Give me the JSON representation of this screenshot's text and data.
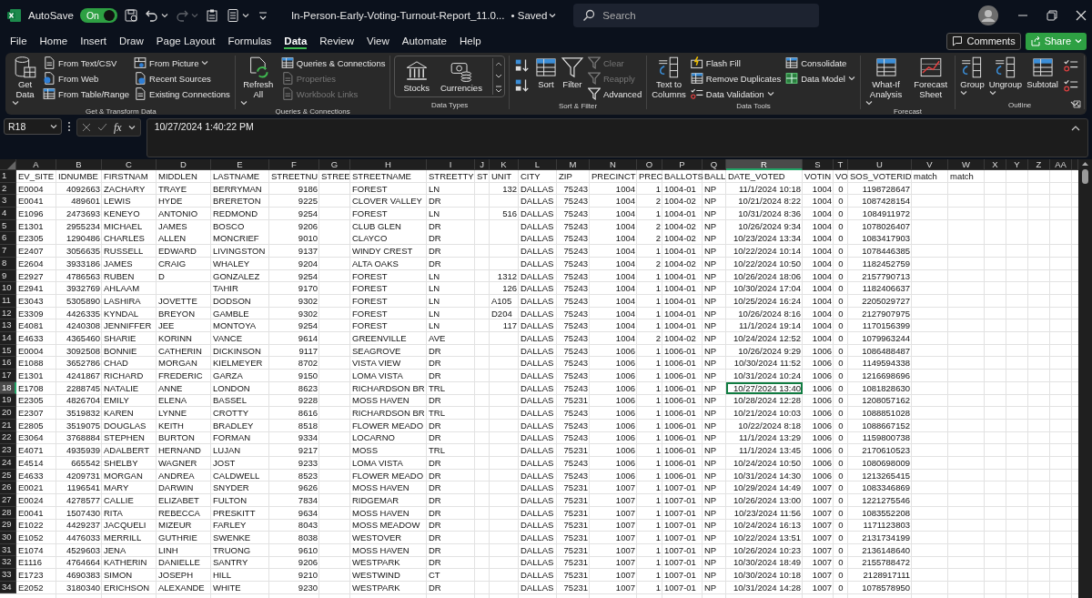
{
  "titlebar": {
    "autosave_label": "AutoSave",
    "autosave": {
      "on": true,
      "label": "On"
    },
    "quick_access": [
      {
        "disabled": false
      },
      {
        "disabled": false
      },
      {
        "disabled": true
      },
      {
        "disabled": false
      },
      {
        "disabled": false
      },
      {
        "disabled": false
      }
    ],
    "title": "In-Person-Early-Voting-Turnout-Report_11.0...",
    "save_status": "• Saved",
    "search": {
      "placeholder": "Search"
    }
  },
  "menu": {
    "tabs": [
      {
        "label": "File",
        "selected": false
      },
      {
        "label": "Home",
        "selected": false
      },
      {
        "label": "Insert",
        "selected": false
      },
      {
        "label": "Draw",
        "selected": false
      },
      {
        "label": "Page Layout",
        "selected": false
      },
      {
        "label": "Formulas",
        "selected": false
      },
      {
        "label": "Data",
        "selected": true
      },
      {
        "label": "Review",
        "selected": false
      },
      {
        "label": "View",
        "selected": false
      },
      {
        "label": "Automate",
        "selected": false
      },
      {
        "label": "Help",
        "selected": false
      }
    ],
    "comments": "Comments",
    "share": "Share"
  },
  "ribbon": {
    "groups": [
      {
        "label": "Get & Transform Data",
        "gallery": false,
        "launcher": false,
        "items": [
          {
            "kind": "large",
            "label": "Get Data",
            "dropdown": true,
            "disabled": false
          },
          {
            "kind": "small",
            "label": "From Text/CSV",
            "dropdown": false,
            "disabled": false
          },
          {
            "kind": "small",
            "label": "From Web",
            "dropdown": false,
            "disabled": false
          },
          {
            "kind": "small",
            "label": "From Table/Range",
            "dropdown": false,
            "disabled": false
          },
          {
            "kind": "small",
            "label": "From Picture",
            "dropdown": true,
            "disabled": false
          },
          {
            "kind": "small",
            "label": "Recent Sources",
            "dropdown": false,
            "disabled": false
          },
          {
            "kind": "small",
            "label": "Existing Connections",
            "dropdown": false,
            "disabled": false
          }
        ]
      },
      {
        "label": "Queries & Connections",
        "gallery": false,
        "launcher": false,
        "items": [
          {
            "kind": "large",
            "label": "Refresh All",
            "dropdown": true,
            "disabled": false
          },
          {
            "kind": "small",
            "label": "Queries & Connections",
            "dropdown": false,
            "disabled": false
          },
          {
            "kind": "small",
            "label": "Properties",
            "dropdown": false,
            "disabled": true
          },
          {
            "kind": "small",
            "label": "Workbook Links",
            "dropdown": false,
            "disabled": true
          }
        ]
      },
      {
        "label": "Data Types",
        "gallery": true,
        "launcher": false,
        "items": [
          {
            "kind": "large",
            "label": "Stocks",
            "dropdown": false,
            "disabled": false
          },
          {
            "kind": "large",
            "label": "Currencies",
            "dropdown": false,
            "disabled": false
          }
        ]
      },
      {
        "label": "Sort & Filter",
        "gallery": false,
        "launcher": false,
        "items": [
          {
            "kind": "icon",
            "dropdown": false,
            "disabled": false
          },
          {
            "kind": "icon",
            "dropdown": false,
            "disabled": false
          },
          {
            "kind": "large",
            "label": "Sort",
            "dropdown": false,
            "disabled": false
          },
          {
            "kind": "large",
            "label": "Filter",
            "dropdown": false,
            "disabled": false
          },
          {
            "kind": "small",
            "label": "Clear",
            "dropdown": false,
            "disabled": true
          },
          {
            "kind": "small",
            "label": "Reapply",
            "dropdown": false,
            "disabled": true
          },
          {
            "kind": "small",
            "label": "Advanced",
            "dropdown": false,
            "disabled": false
          }
        ]
      },
      {
        "label": "Data Tools",
        "gallery": false,
        "launcher": false,
        "items": [
          {
            "kind": "large",
            "label": "Text to Columns",
            "dropdown": false,
            "disabled": false
          },
          {
            "kind": "small",
            "label": "Flash Fill",
            "dropdown": false,
            "disabled": false
          },
          {
            "kind": "small",
            "label": "Remove Duplicates",
            "dropdown": false,
            "disabled": false
          },
          {
            "kind": "small",
            "label": "Data Validation",
            "dropdown": true,
            "disabled": false
          },
          {
            "kind": "small",
            "label": "Consolidate",
            "dropdown": false,
            "disabled": false
          },
          {
            "kind": "small",
            "label": "Data Model",
            "dropdown": true,
            "disabled": false
          }
        ]
      },
      {
        "label": "Forecast",
        "gallery": false,
        "launcher": false,
        "items": [
          {
            "kind": "large",
            "label": "What-If Analysis",
            "dropdown": true,
            "disabled": false
          },
          {
            "kind": "large",
            "label": "Forecast Sheet",
            "dropdown": false,
            "disabled": false
          }
        ]
      },
      {
        "label": "Outline",
        "gallery": false,
        "launcher": true,
        "items": [
          {
            "kind": "large",
            "label": "Group",
            "dropdown": true,
            "disabled": false
          },
          {
            "kind": "large",
            "label": "Ungroup",
            "dropdown": true,
            "disabled": false
          },
          {
            "kind": "large",
            "label": "Subtotal",
            "dropdown": false,
            "disabled": false
          },
          {
            "kind": "icon",
            "dropdown": false,
            "disabled": false
          },
          {
            "kind": "icon",
            "dropdown": false,
            "disabled": false
          }
        ]
      }
    ]
  },
  "formula_bar": {
    "name_box": "R18",
    "fx": "fx",
    "value": "10/27/2024 1:40:22 PM"
  },
  "sheet": {
    "columns": [
      {
        "letter": "A",
        "kind": "text",
        "selected": false
      },
      {
        "letter": "B",
        "kind": "number",
        "selected": false
      },
      {
        "letter": "C",
        "kind": "text",
        "selected": false
      },
      {
        "letter": "D",
        "kind": "text",
        "selected": false
      },
      {
        "letter": "E",
        "kind": "text",
        "selected": false
      },
      {
        "letter": "F",
        "kind": "number",
        "selected": false
      },
      {
        "letter": "G",
        "kind": "text",
        "selected": false
      },
      {
        "letter": "H",
        "kind": "text",
        "selected": false
      },
      {
        "letter": "I",
        "kind": "text",
        "selected": false
      },
      {
        "letter": "J",
        "kind": "text",
        "selected": false
      },
      {
        "letter": "K",
        "kind": "number",
        "selected": false
      },
      {
        "letter": "L",
        "kind": "text",
        "selected": false
      },
      {
        "letter": "M",
        "kind": "number",
        "selected": false
      },
      {
        "letter": "N",
        "kind": "number",
        "selected": false
      },
      {
        "letter": "O",
        "kind": "number",
        "selected": false
      },
      {
        "letter": "P",
        "kind": "text",
        "selected": false
      },
      {
        "letter": "Q",
        "kind": "text",
        "selected": false
      },
      {
        "letter": "R",
        "kind": "number",
        "selected": true
      },
      {
        "letter": "S",
        "kind": "number",
        "selected": false
      },
      {
        "letter": "T",
        "kind": "flag",
        "selected": false
      },
      {
        "letter": "U",
        "kind": "number",
        "selected": false
      },
      {
        "letter": "V",
        "kind": "text",
        "selected": false
      },
      {
        "letter": "W",
        "kind": "text",
        "selected": false
      },
      {
        "letter": "X",
        "selected": false
      },
      {
        "letter": "Y",
        "selected": false
      },
      {
        "letter": "Z",
        "selected": false
      },
      {
        "letter": "AA",
        "selected": false
      }
    ],
    "rows": [
      {
        "number": "1",
        "kind": "header",
        "selected": false,
        "cells": [
          "EV_SITE",
          "IDNUMBE",
          "FIRSTNAM",
          "MIDDLEN",
          "LASTNAME",
          "STREETNU",
          "STREE",
          "STREETNAME",
          "STREETTY",
          "ST",
          "UNIT",
          "CITY",
          "ZIP",
          "PRECINCT",
          "PREC",
          "BALLOTS",
          "BALL",
          "DATE_VOTED",
          "VOTIN",
          "VO",
          "SOS_VOTERID",
          "match",
          "match"
        ]
      },
      {
        "number": "2",
        "kind": "data",
        "selected": false,
        "cells": [
          "E0004",
          "4092663",
          "ZACHARY",
          "TRAYE",
          "BERRYMAN",
          "9186",
          null,
          "FOREST",
          "LN",
          null,
          "132",
          "DALLAS",
          "75243",
          "1004",
          "1",
          "1004-01",
          "NP",
          "11/1/2024 10:18",
          "1004",
          "0",
          "1198728647"
        ]
      },
      {
        "number": "3",
        "kind": "data",
        "selected": false,
        "cells": [
          "E0041",
          "489601",
          "LEWIS",
          "HYDE",
          "BRERETON",
          "9225",
          null,
          "CLOVER VALLEY",
          "DR",
          null,
          null,
          "DALLAS",
          "75243",
          "1004",
          "2",
          "1004-02",
          "NP",
          "10/21/2024 8:22",
          "1004",
          "0",
          "1087428154"
        ]
      },
      {
        "number": "4",
        "kind": "data",
        "selected": false,
        "cells": [
          "E1096",
          "2473693",
          "KENEYO",
          "ANTONIO",
          "REDMOND",
          "9254",
          null,
          "FOREST",
          "LN",
          null,
          "516",
          "DALLAS",
          "75243",
          "1004",
          "1",
          "1004-01",
          "NP",
          "10/31/2024 8:36",
          "1004",
          "0",
          "1084911972"
        ]
      },
      {
        "number": "5",
        "kind": "data",
        "selected": false,
        "cells": [
          "E1301",
          "2955234",
          "MICHAEL",
          "JAMES",
          "BOSCO",
          "9206",
          null,
          "CLUB GLEN",
          "DR",
          null,
          null,
          "DALLAS",
          "75243",
          "1004",
          "2",
          "1004-02",
          "NP",
          "10/26/2024 9:34",
          "1004",
          "0",
          "1078026407"
        ]
      },
      {
        "number": "6",
        "kind": "data",
        "selected": false,
        "cells": [
          "E2305",
          "1290486",
          "CHARLES",
          "ALLEN",
          "MONCRIEF",
          "9010",
          null,
          "CLAYCO",
          "DR",
          null,
          null,
          "DALLAS",
          "75243",
          "1004",
          "2",
          "1004-02",
          "NP",
          "10/23/2024 13:34",
          "1004",
          "0",
          "1083417903"
        ]
      },
      {
        "number": "7",
        "kind": "data",
        "selected": false,
        "cells": [
          "E2407",
          "3056635",
          "RUSSELL",
          "EDWARD",
          "LIVINGSTON",
          "9137",
          null,
          "WINDY CREST",
          "DR",
          null,
          null,
          "DALLAS",
          "75243",
          "1004",
          "1",
          "1004-01",
          "NP",
          "10/22/2024 10:14",
          "1004",
          "0",
          "1078446385"
        ]
      },
      {
        "number": "8",
        "kind": "data",
        "selected": false,
        "cells": [
          "E2604",
          "3933186",
          "JAMES",
          "CRAIG",
          "WHALEY",
          "9204",
          null,
          "ALTA OAKS",
          "DR",
          null,
          null,
          "DALLAS",
          "75243",
          "1004",
          "2",
          "1004-02",
          "NP",
          "10/22/2024 10:50",
          "1004",
          "0",
          "1182452759"
        ]
      },
      {
        "number": "9",
        "kind": "data",
        "selected": false,
        "cells": [
          "E2927",
          "4786563",
          "RUBEN",
          "D",
          "GONZALEZ",
          "9254",
          null,
          "FOREST",
          "LN",
          null,
          "1312",
          "DALLAS",
          "75243",
          "1004",
          "1",
          "1004-01",
          "NP",
          "10/26/2024 18:06",
          "1004",
          "0",
          "2157790713"
        ]
      },
      {
        "number": "10",
        "kind": "data",
        "selected": false,
        "cells": [
          "E2941",
          "3932769",
          "AHLAAM",
          null,
          "TAHIR",
          "9170",
          null,
          "FOREST",
          "LN",
          null,
          "126",
          "DALLAS",
          "75243",
          "1004",
          "1",
          "1004-01",
          "NP",
          "10/30/2024 17:04",
          "1004",
          "0",
          "1182406637"
        ]
      },
      {
        "number": "11",
        "kind": "data",
        "selected": false,
        "cells": [
          "E3043",
          "5305890",
          "LASHIRA",
          "JOVETTE",
          "DODSON",
          "9302",
          null,
          "FOREST",
          "LN",
          null,
          {
            "text": "A105",
            "kind": "text"
          },
          "DALLAS",
          "75243",
          "1004",
          "1",
          "1004-01",
          "NP",
          "10/25/2024 16:24",
          "1004",
          "0",
          "2205029727"
        ]
      },
      {
        "number": "12",
        "kind": "data",
        "selected": false,
        "cells": [
          "E3309",
          "4426335",
          "KYNDAL",
          "BREYON",
          "GAMBLE",
          "9302",
          null,
          "FOREST",
          "LN",
          null,
          {
            "text": "D204",
            "kind": "text"
          },
          "DALLAS",
          "75243",
          "1004",
          "1",
          "1004-01",
          "NP",
          "10/26/2024 8:16",
          "1004",
          "0",
          "2127907975"
        ]
      },
      {
        "number": "13",
        "kind": "data",
        "selected": false,
        "cells": [
          "E4081",
          "4240308",
          "JENNIFFER",
          "JEE",
          "MONTOYA",
          "9254",
          null,
          "FOREST",
          "LN",
          null,
          "117",
          "DALLAS",
          "75243",
          "1004",
          "1",
          "1004-01",
          "NP",
          "11/1/2024 19:14",
          "1004",
          "0",
          "1170156399"
        ]
      },
      {
        "number": "14",
        "kind": "data",
        "selected": false,
        "cells": [
          "E4633",
          "4365460",
          "SHARIE",
          "KORINN",
          "VANCE",
          "9614",
          null,
          "GREENVILLE",
          "AVE",
          null,
          null,
          "DALLAS",
          "75243",
          "1004",
          "2",
          "1004-02",
          "NP",
          "10/24/2024 12:52",
          "1004",
          "0",
          "1079963244"
        ]
      },
      {
        "number": "15",
        "kind": "data",
        "selected": false,
        "cells": [
          "E0004",
          "3092508",
          "BONNIE",
          "CATHERIN",
          "DICKINSON",
          "9117",
          null,
          "SEAGROVE",
          "DR",
          null,
          null,
          "DALLAS",
          "75243",
          "1006",
          "1",
          "1006-01",
          "NP",
          "10/26/2024 9:29",
          "1006",
          "0",
          "1086488487"
        ]
      },
      {
        "number": "16",
        "kind": "data",
        "selected": false,
        "cells": [
          "E1088",
          "3652786",
          "CHAD",
          "MORGAN",
          "KIELMEYER",
          "8702",
          null,
          "VISTA VIEW",
          "DR",
          null,
          null,
          "DALLAS",
          "75243",
          "1006",
          "1",
          "1006-01",
          "NP",
          "10/30/2024 11:52",
          "1006",
          "0",
          "1149594338"
        ]
      },
      {
        "number": "17",
        "kind": "data",
        "selected": false,
        "cells": [
          "E1301",
          "4241867",
          "RICHARD",
          "FREDERIC",
          "GARZA",
          "9150",
          null,
          "LOMA VISTA",
          "DR",
          null,
          null,
          "DALLAS",
          "75243",
          "1006",
          "1",
          "1006-01",
          "NP",
          "10/31/2024 10:24",
          "1006",
          "0",
          "1216698696"
        ]
      },
      {
        "number": "18",
        "kind": "data",
        "selected": true,
        "cells": [
          "E1708",
          "2288745",
          "NATALIE",
          "ANNE",
          "LONDON",
          "8623",
          null,
          "RICHARDSON BR",
          "TRL",
          null,
          null,
          "DALLAS",
          "75243",
          "1006",
          "1",
          "1006-01",
          "NP",
          "10/27/2024 13:40",
          "1006",
          "0",
          "1081828630"
        ]
      },
      {
        "number": "19",
        "kind": "data",
        "selected": false,
        "cells": [
          "E2305",
          "4826704",
          "EMILY",
          "ELENA",
          "BASSEL",
          "9228",
          null,
          "MOSS HAVEN",
          "DR",
          null,
          null,
          "DALLAS",
          "75231",
          "1006",
          "1",
          "1006-01",
          "NP",
          "10/28/2024 12:28",
          "1006",
          "0",
          "1208057162"
        ]
      },
      {
        "number": "20",
        "kind": "data",
        "selected": false,
        "cells": [
          "E2307",
          "3519832",
          "KAREN",
          "LYNNE",
          "CROTTY",
          "8616",
          null,
          "RICHARDSON BR",
          "TRL",
          null,
          null,
          "DALLAS",
          "75243",
          "1006",
          "1",
          "1006-01",
          "NP",
          "10/21/2024 10:03",
          "1006",
          "0",
          "1088851028"
        ]
      },
      {
        "number": "21",
        "kind": "data",
        "selected": false,
        "cells": [
          "E2805",
          "3519075",
          "DOUGLAS",
          "KEITH",
          "BRADLEY",
          "8518",
          null,
          "FLOWER MEADO",
          "DR",
          null,
          null,
          "DALLAS",
          "75243",
          "1006",
          "1",
          "1006-01",
          "NP",
          "10/22/2024 8:18",
          "1006",
          "0",
          "1088667152"
        ]
      },
      {
        "number": "22",
        "kind": "data",
        "selected": false,
        "cells": [
          "E3064",
          "3768884",
          "STEPHEN",
          "BURTON",
          "FORMAN",
          "9334",
          null,
          "LOCARNO",
          "DR",
          null,
          null,
          "DALLAS",
          "75243",
          "1006",
          "1",
          "1006-01",
          "NP",
          "11/1/2024 13:29",
          "1006",
          "0",
          "1159800738"
        ]
      },
      {
        "number": "23",
        "kind": "data",
        "selected": false,
        "cells": [
          "E4071",
          "4935939",
          "ADALBERT",
          "HERNAND",
          "LUJAN",
          "9217",
          null,
          "MOSS",
          "TRL",
          null,
          null,
          "DALLAS",
          "75231",
          "1006",
          "1",
          "1006-01",
          "NP",
          "11/1/2024 13:45",
          "1006",
          "0",
          "2170610523"
        ]
      },
      {
        "number": "24",
        "kind": "data",
        "selected": false,
        "cells": [
          "E4514",
          "665542",
          "SHELBY",
          "WAGNER",
          "JOST",
          "9233",
          null,
          "LOMA VISTA",
          "DR",
          null,
          null,
          "DALLAS",
          "75243",
          "1006",
          "1",
          "1006-01",
          "NP",
          "10/24/2024 10:50",
          "1006",
          "0",
          "1080698009"
        ]
      },
      {
        "number": "25",
        "kind": "data",
        "selected": false,
        "cells": [
          "E4633",
          "4209731",
          "MORGAN",
          "ANDREA",
          "CALDWELL",
          "8523",
          null,
          "FLOWER MEADO",
          "DR",
          null,
          null,
          "DALLAS",
          "75243",
          "1006",
          "1",
          "1006-01",
          "NP",
          "10/31/2024 14:30",
          "1006",
          "0",
          "1213265415"
        ]
      },
      {
        "number": "26",
        "kind": "data",
        "selected": false,
        "cells": [
          "E0021",
          "1196541",
          "MARY",
          "DARWIN",
          "SNYDER",
          "9626",
          null,
          "MOSS HAVEN",
          "DR",
          null,
          null,
          "DALLAS",
          "75231",
          "1007",
          "1",
          "1007-01",
          "NP",
          "10/29/2024 14:49",
          "1007",
          "0",
          "1083346869"
        ]
      },
      {
        "number": "27",
        "kind": "data",
        "selected": false,
        "cells": [
          "E0024",
          "4278577",
          "CALLIE",
          "ELIZABET",
          "FULTON",
          "7834",
          null,
          "RIDGEMAR",
          "DR",
          null,
          null,
          "DALLAS",
          "75231",
          "1007",
          "1",
          "1007-01",
          "NP",
          "10/26/2024 13:00",
          "1007",
          "0",
          "1221275546"
        ]
      },
      {
        "number": "28",
        "kind": "data",
        "selected": false,
        "cells": [
          "E0041",
          "1507430",
          "RITA",
          "REBECCA",
          "PRESKITT",
          "9634",
          null,
          "MOSS HAVEN",
          "DR",
          null,
          null,
          "DALLAS",
          "75231",
          "1007",
          "1",
          "1007-01",
          "NP",
          "10/23/2024 11:56",
          "1007",
          "0",
          "1083552208"
        ]
      },
      {
        "number": "29",
        "kind": "data",
        "selected": false,
        "cells": [
          "E1022",
          "4429237",
          "JACQUELI",
          "MIZEUR",
          "FARLEY",
          "8043",
          null,
          "MOSS MEADOW",
          "DR",
          null,
          null,
          "DALLAS",
          "75231",
          "1007",
          "1",
          "1007-01",
          "NP",
          "10/24/2024 16:13",
          "1007",
          "0",
          "1171123803"
        ]
      },
      {
        "number": "30",
        "kind": "data",
        "selected": false,
        "cells": [
          "E1052",
          "4476033",
          "MERRILL",
          "GUTHRIE",
          "SWENKE",
          "8038",
          null,
          "WESTOVER",
          "DR",
          null,
          null,
          "DALLAS",
          "75231",
          "1007",
          "1",
          "1007-01",
          "NP",
          "10/22/2024 13:51",
          "1007",
          "0",
          "2131734199"
        ]
      },
      {
        "number": "31",
        "kind": "data",
        "selected": false,
        "cells": [
          "E1074",
          "4529603",
          "JENA",
          "LINH",
          "TRUONG",
          "9610",
          null,
          "MOSS HAVEN",
          "DR",
          null,
          null,
          "DALLAS",
          "75231",
          "1007",
          "1",
          "1007-01",
          "NP",
          "10/26/2024 10:23",
          "1007",
          "0",
          "2136148640"
        ]
      },
      {
        "number": "32",
        "kind": "data",
        "selected": false,
        "cells": [
          "E1116",
          "4764664",
          "KATHERIN",
          "DANIELLE",
          "SANTRY",
          "9206",
          null,
          "WESTPARK",
          "DR",
          null,
          null,
          "DALLAS",
          "75231",
          "1007",
          "1",
          "1007-01",
          "NP",
          "10/30/2024 18:49",
          "1007",
          "0",
          "2155788472"
        ]
      },
      {
        "number": "33",
        "kind": "data",
        "selected": false,
        "cells": [
          "E1723",
          "4690383",
          "SIMON",
          "JOSEPH",
          "HILL",
          "9210",
          null,
          "WESTWIND",
          "CT",
          null,
          null,
          "DALLAS",
          "75231",
          "1007",
          "1",
          "1007-01",
          "NP",
          "10/30/2024 10:18",
          "1007",
          "0",
          "2128917111"
        ]
      },
      {
        "number": "34",
        "kind": "data",
        "selected": false,
        "cells": [
          "E2052",
          "3180340",
          "ERICHSON",
          "ALEXANDE",
          "WHITE",
          "9230",
          null,
          "WESTPARK",
          "DR",
          null,
          null,
          "DALLAS",
          "75231",
          "1007",
          "1",
          "1007-01",
          "NP",
          "10/31/2024 14:28",
          "1007",
          "0",
          "1078578950"
        ]
      }
    ]
  }
}
